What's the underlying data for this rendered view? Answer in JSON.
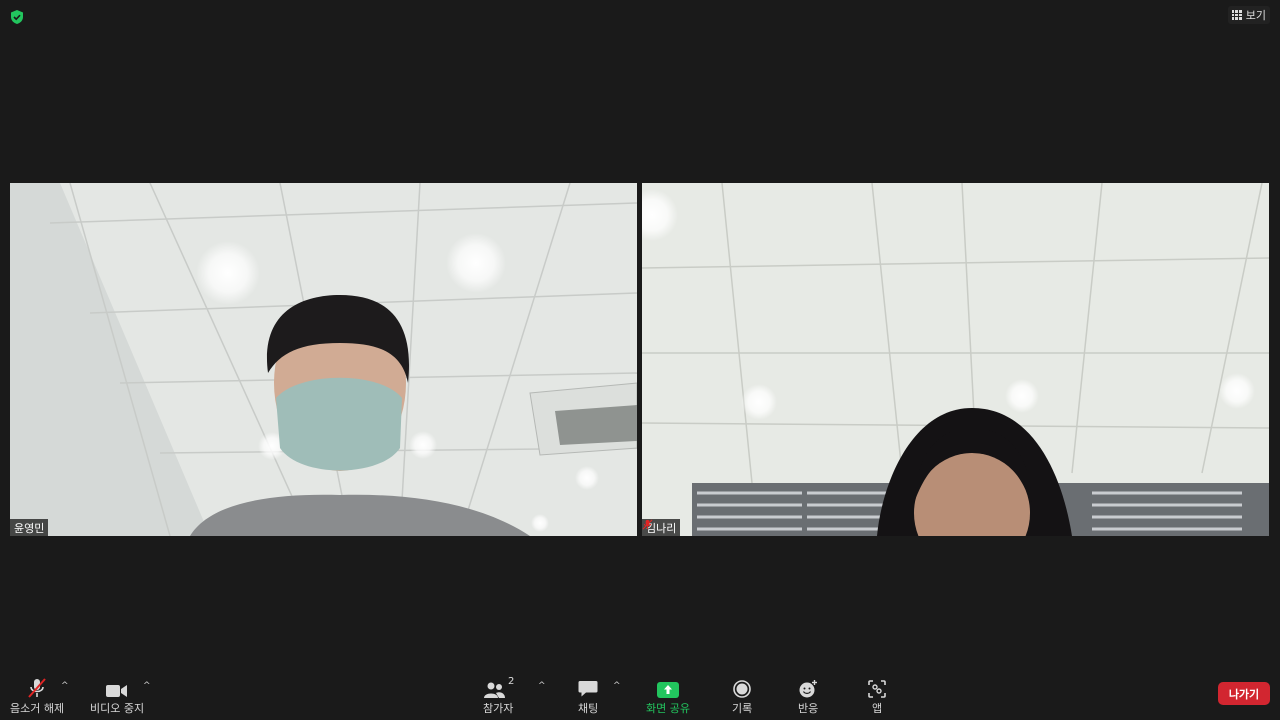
{
  "top": {
    "shield_icon": "shield-check-icon",
    "view_label": "보기"
  },
  "participants": [
    {
      "name": "윤영민",
      "muted": false
    },
    {
      "name": "김나리",
      "muted": true
    }
  ],
  "toolbar": {
    "unmute_label": "음소거 해제",
    "video_label": "비디오 중지",
    "participants_label": "참가자",
    "participants_count": "2",
    "chat_label": "채팅",
    "share_label": "화면 공유",
    "record_label": "기록",
    "reactions_label": "반응",
    "apps_label": "앱",
    "leave_label": "나가기"
  },
  "colors": {
    "background": "#1a1a1a",
    "share_green": "#22c55e",
    "leave_red": "#d22630",
    "mute_red": "#e02424"
  }
}
